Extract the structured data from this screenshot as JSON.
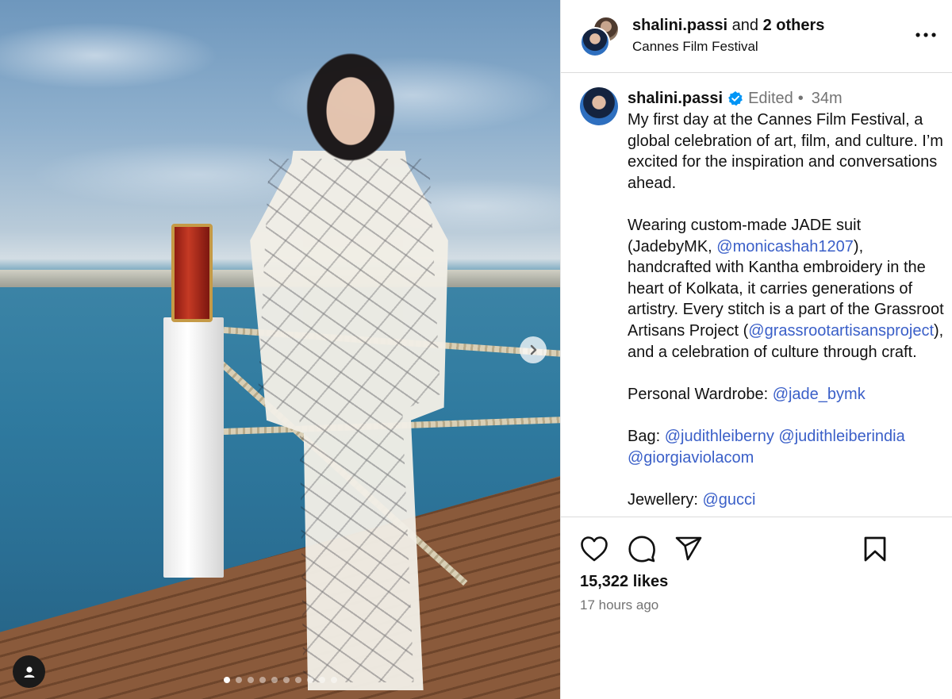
{
  "header": {
    "username": "shalini.passi",
    "and_text": "and",
    "others": "2 others",
    "location": "Cannes Film Festival"
  },
  "caption": {
    "username": "shalini.passi",
    "edited": "Edited",
    "separator": "•",
    "age": "34m",
    "p1": "My first day at the Cannes Film Festival, a global celebration of art, film, and culture. I’m excited for the inspiration and conversations ahead.",
    "p2_a": "Wearing custom-made JADE suit (JadebyMK, ",
    "p2_m1": "@monicashah1207",
    "p2_b": "), handcrafted with Kantha embroidery in the heart of Kolkata, it carries generations of artistry. Every stitch is a part of the Grassroot Artisans Project (",
    "p2_m2": "@grassrootartisansproject",
    "p2_c": "), and a celebration of culture through craft.",
    "p3_a": "Personal Wardrobe: ",
    "p3_m": "@jade_bymk",
    "p4_a": "Bag: ",
    "p4_m1": "@judithleiberny",
    "p4_space": " ",
    "p4_m2": "@judithleiberindia",
    "p4_m3": "@giorgiaviolacom",
    "p5_a": "Jewellery: ",
    "p5_m": "@gucci"
  },
  "footer": {
    "likes": "15,322 likes",
    "posted": "17 hours ago"
  },
  "carousel": {
    "count": 10,
    "active_index": 0
  },
  "colors": {
    "link": "#3a5fc8",
    "verified": "#0095f6",
    "muted": "#737373"
  },
  "icons": [
    "more-options-icon",
    "verified-badge-icon",
    "heart-icon",
    "comment-icon",
    "share-icon",
    "bookmark-icon",
    "chevron-right-icon",
    "tagged-user-icon"
  ]
}
